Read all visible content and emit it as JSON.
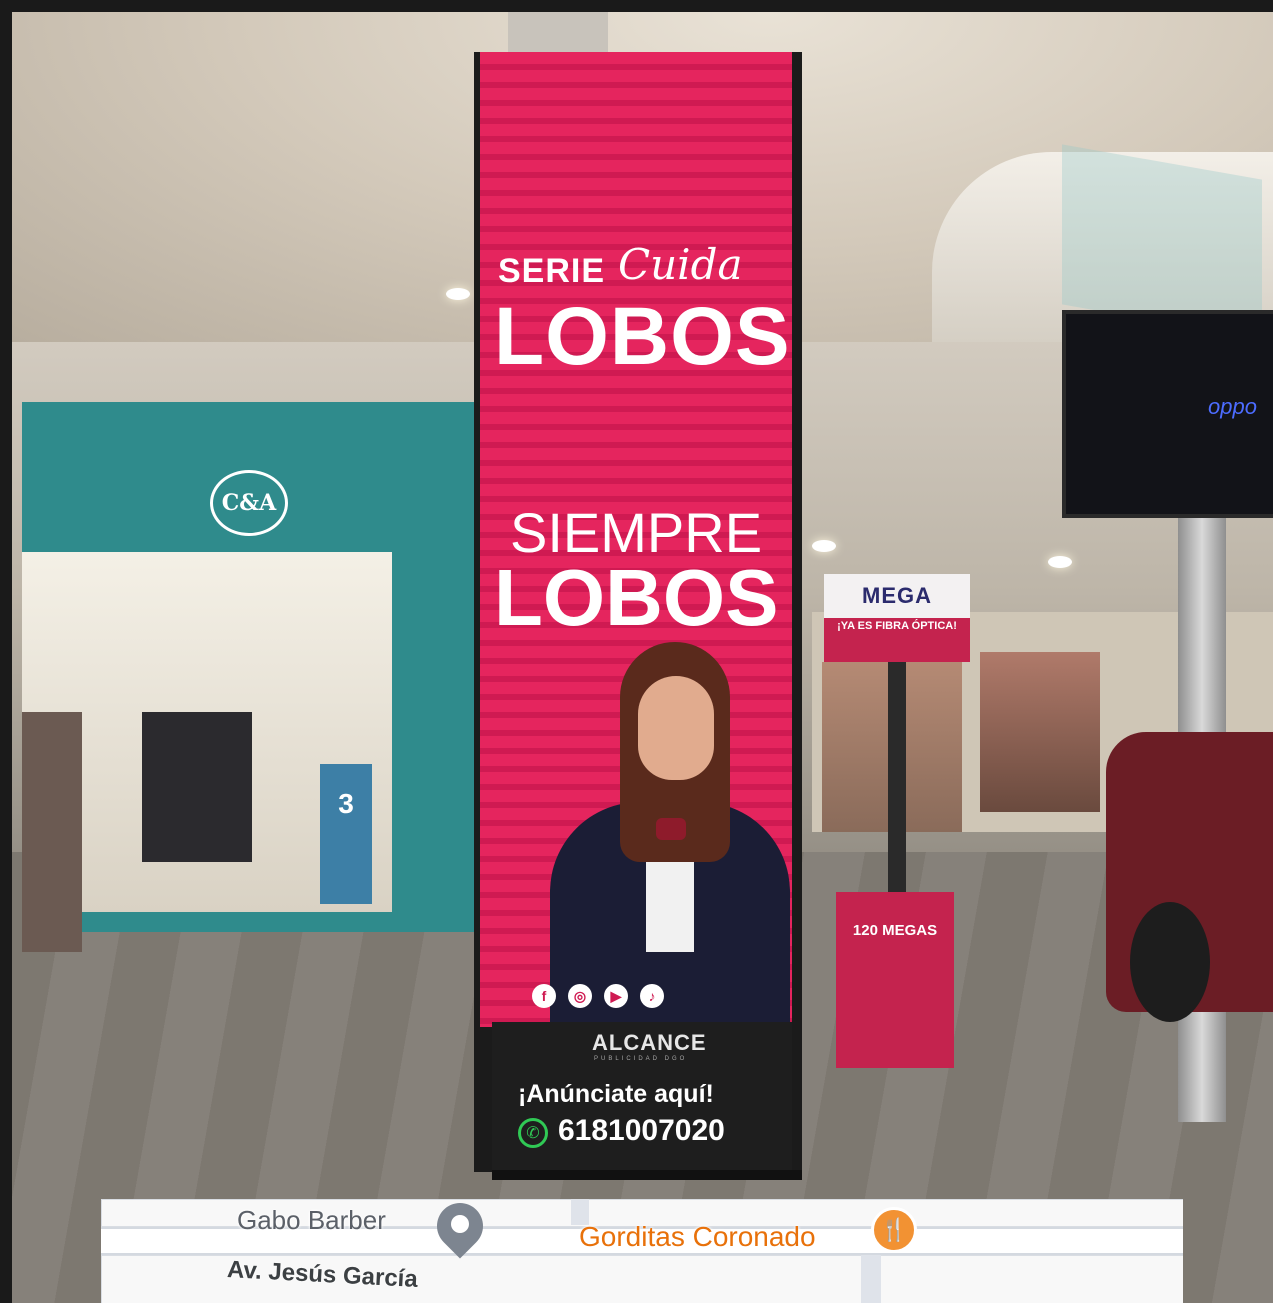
{
  "storefront": {
    "logo": "C&A",
    "stand_number": "3"
  },
  "ad": {
    "line1": "SERIE",
    "cursive": "Cuida",
    "line2": "LOBOS",
    "line3": "SIEMPRE",
    "line4": "LOBOS",
    "social_icons": [
      "facebook-icon",
      "instagram-icon",
      "youtube-icon",
      "tiktok-icon"
    ]
  },
  "totem_base": {
    "brand": "ALCANCE",
    "brand_sub": "PUBLICIDAD DGO",
    "cta": "¡Anúnciate aquí!",
    "phone": "6181007020"
  },
  "mega": {
    "sign_top": "MEGA",
    "sign_bottom": "¡YA ES FIBRA ÓPTICA!",
    "box_text": "120 MEGAS"
  },
  "tv": {
    "brand": "oppo"
  },
  "map": {
    "place1": "Gabo Barber",
    "place2": "Gorditas Coronado",
    "street": "Av. Jesús García"
  },
  "colors": {
    "ad_pink": "#e5255e",
    "storefront_teal": "#2f8b8c",
    "mega_red": "#c4234e",
    "whatsapp_green": "#30c955"
  }
}
